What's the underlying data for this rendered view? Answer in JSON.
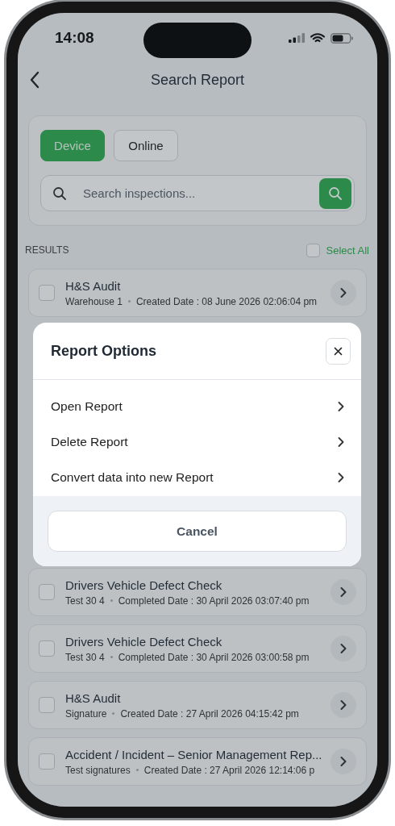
{
  "status_bar": {
    "time": "14:08"
  },
  "header": {
    "title": "Search Report"
  },
  "source_tabs": [
    {
      "label": "Device",
      "selected": true
    },
    {
      "label": "Online",
      "selected": false
    }
  ],
  "search": {
    "placeholder": "Search inspections..."
  },
  "results": {
    "label": "RESULTS",
    "select_all": {
      "label": "Select All",
      "checked": false
    }
  },
  "reports_above": [
    {
      "title": "H&S Audit",
      "location": "Warehouse 1",
      "date": "Created Date : 08 June 2026 02:06:04 pm",
      "checked": false
    }
  ],
  "reports_below": [
    {
      "title": "Drivers Vehicle Defect Check",
      "location": "Test 30 4",
      "date": "Completed Date : 30 April 2026 03:07:40 pm",
      "checked": false
    },
    {
      "title": "Drivers Vehicle Defect Check",
      "location": "Test 30 4",
      "date": "Completed Date : 30 April 2026 03:00:58 pm",
      "checked": false
    },
    {
      "title": "H&S Audit",
      "location": "Signature",
      "date": "Created Date : 27 April 2026 04:15:42 pm",
      "checked": false
    },
    {
      "title": "Accident / Incident – Senior Management Rep...",
      "location": "Test signatures",
      "date": "Created Date : 27 April 2026 12:14:06 p",
      "checked": false
    }
  ],
  "modal": {
    "title": "Report Options",
    "options": [
      "Open Report",
      "Delete Report",
      "Convert data into new Report"
    ],
    "cancel": "Cancel"
  }
}
